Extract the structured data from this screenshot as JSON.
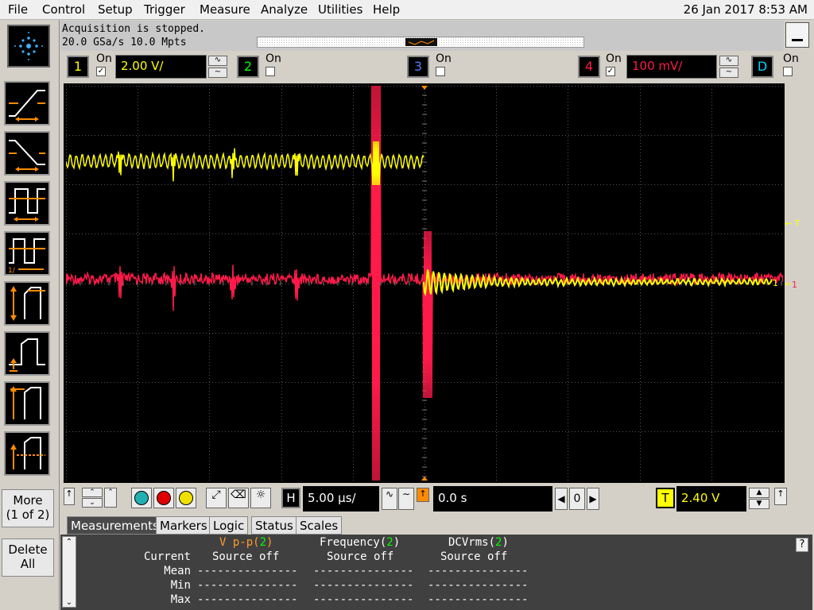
{
  "menu": [
    "File",
    "Control",
    "Setup",
    "Trigger",
    "Measure",
    "Analyze",
    "Utilities",
    "Help"
  ],
  "datetime": "26 Jan 2017   8:53 AM",
  "acquisition": {
    "line1": "Acquisition is stopped.",
    "line2": "20.0 GSa/s   10.0 Mpts"
  },
  "channels": [
    {
      "num": "1",
      "on_label": "On",
      "checked": true,
      "scale": "2.00 V/",
      "color": "#ffff00"
    },
    {
      "num": "2",
      "on_label": "On",
      "checked": false,
      "color": "#00ff00"
    },
    {
      "num": "3",
      "on_label": "On",
      "checked": false,
      "color": "#4060ff"
    },
    {
      "num": "4",
      "on_label": "On",
      "checked": true,
      "scale": "100 mV/",
      "color": "#ff1a4a"
    },
    {
      "num": "D",
      "on_label": "On",
      "checked": false,
      "color": "#00d0ff"
    }
  ],
  "sidebar": {
    "more": "More",
    "more_sub": "(1 of 2)",
    "delete": "Delete",
    "delete_sub": "All"
  },
  "timebase": {
    "h_label": "H",
    "scale": "5.00 µs/",
    "delay": "0.0 s",
    "delay_ref": "0"
  },
  "trigger": {
    "t_label": "T",
    "level": "2.40 V"
  },
  "markers": {
    "trigger_right": "T",
    "ch1_level": "1",
    "ch4_level": "1"
  },
  "tabs": [
    "Measurements",
    "Markers",
    "Logic",
    "Status",
    "Scales"
  ],
  "measurements": {
    "headers": [
      {
        "name": "V p-p(",
        "src": "2",
        "close": ")",
        "color": "#ff9a2a"
      },
      {
        "name": "Frequency(",
        "src": "2",
        "close": ")",
        "color": "#ffffff"
      },
      {
        "name": "DCVrms(",
        "src": "2",
        "close": ")",
        "color": "#ffffff"
      }
    ],
    "rows": [
      {
        "label": "Current",
        "values": [
          "Source off",
          "Source off",
          "Source off"
        ]
      },
      {
        "label": "Mean",
        "values": [
          "---------------",
          "---------------",
          "---------------"
        ]
      },
      {
        "label": "Min",
        "values": [
          "---------------",
          "---------------",
          "---------------"
        ]
      },
      {
        "label": "Max",
        "values": [
          "---------------",
          "---------------",
          "---------------"
        ]
      }
    ]
  },
  "help_icon": "?",
  "colors": {
    "ch1": "#ffff00",
    "ch4": "#ff1a4a",
    "accent_orange": "#ff8c00",
    "grid": "#5a5a5a"
  }
}
